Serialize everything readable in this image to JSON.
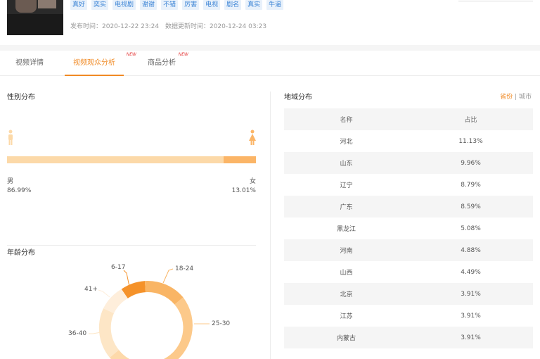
{
  "header": {
    "tags": [
      "真好",
      "奕实",
      "电视剧",
      "谢谢",
      "不错",
      "厉害",
      "电视",
      "剧名",
      "真实",
      "牛逼"
    ],
    "publish_time": "发布时间：2020-12-22 23:24",
    "update_time": "数据更新时间：2020-12-24 03:23"
  },
  "tabs": [
    {
      "label": "视频详情",
      "new": ""
    },
    {
      "label": "视频观众分析",
      "new": "NEW"
    },
    {
      "label": "商品分析",
      "new": "NEW"
    }
  ],
  "gender": {
    "title": "性别分布",
    "male_label": "男",
    "female_label": "女",
    "male_pct": "86.99%",
    "female_pct": "13.01%",
    "male_value": 86.99,
    "female_value": 13.01,
    "colors": {
      "male": "#fcd9a8",
      "female": "#fbb567"
    }
  },
  "age": {
    "title": "年龄分布",
    "segments": [
      {
        "label": "6-17"
      },
      {
        "label": "18-24"
      },
      {
        "label": "25-30"
      },
      {
        "label": "36-40"
      },
      {
        "label": "41+"
      }
    ]
  },
  "region": {
    "title": "地域分布",
    "toggle_on": "省份",
    "toggle_sep": "|",
    "toggle_off": "城市",
    "columns": [
      "名称",
      "占比"
    ],
    "rows": [
      [
        "河北",
        "11.13%"
      ],
      [
        "山东",
        "9.96%"
      ],
      [
        "辽宁",
        "8.79%"
      ],
      [
        "广东",
        "8.59%"
      ],
      [
        "黑龙江",
        "5.08%"
      ],
      [
        "河南",
        "4.88%"
      ],
      [
        "山西",
        "4.49%"
      ],
      [
        "北京",
        "3.91%"
      ],
      [
        "江苏",
        "3.91%"
      ],
      [
        "内蒙古",
        "3.91%"
      ]
    ]
  },
  "colors": {
    "accent": "#f08a24",
    "tag_blue": "#3f86d6",
    "new_red": "#e43b3b"
  }
}
